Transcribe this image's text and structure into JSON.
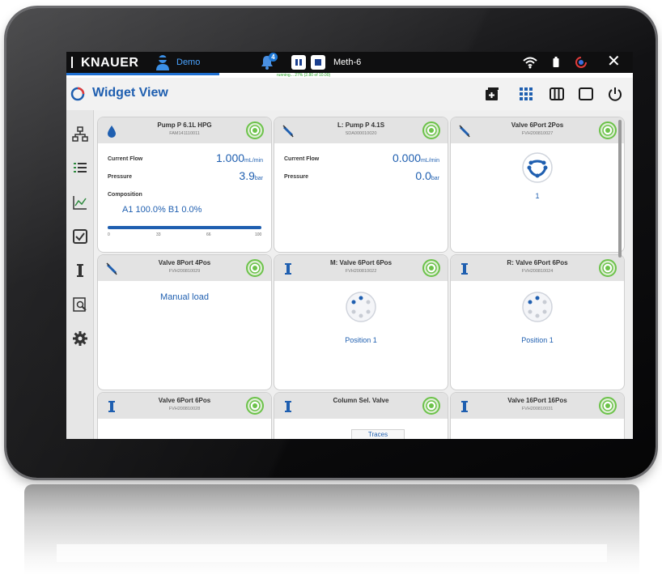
{
  "header": {
    "brand": "KNAUER",
    "user": "Demo",
    "notification_count": "4",
    "method": "Meth-6",
    "progress_text": "running... 27% (2.80 of 10.00)",
    "progress_fraction": 0.27
  },
  "titlebar": {
    "title": "Widget View"
  },
  "widgets": [
    {
      "title": "Pump P 6.1L HPG",
      "serial": "FAM141110011",
      "current_flow_label": "Current Flow",
      "current_flow_value": "1.000",
      "current_flow_unit": "mL/min",
      "pressure_label": "Pressure",
      "pressure_value": "3.9",
      "pressure_unit": "bar",
      "composition_label": "Composition",
      "composition_value": "A1 100.0% B1 0.0%",
      "bar_ticks": [
        "0",
        "33",
        "66",
        "100"
      ],
      "bar_fraction": 1.0
    },
    {
      "title": "L: Pump P 4.1S",
      "serial": "SDA000010020",
      "current_flow_label": "Current Flow",
      "current_flow_value": "0.000",
      "current_flow_unit": "mL/min",
      "pressure_label": "Pressure",
      "pressure_value": "0.0",
      "pressure_unit": "bar"
    },
    {
      "title": "Valve 6Port 2Pos",
      "serial": "FVH200810027",
      "position": "1"
    },
    {
      "title": "Valve 8Port 4Pos",
      "serial": "FVH200810029",
      "status": "Manual load"
    },
    {
      "title": "M: Valve 6Port 6Pos",
      "serial": "FVH200810022",
      "position": "Position 1"
    },
    {
      "title": "R: Valve 6Port 6Pos",
      "serial": "FVH200810024",
      "position": "Position 1"
    },
    {
      "title": "Valve 6Port 6Pos",
      "serial": "FVH200810028"
    },
    {
      "title": "Column Sel. Valve",
      "serial": ""
    },
    {
      "title": "Valve 16Port 16Pos",
      "serial": "FVH200810031"
    }
  ],
  "traces_tab": "Traces",
  "colors": {
    "accent": "#1f5fb0",
    "status_green": "#6cc24a",
    "topbar": "#0f0f10"
  }
}
